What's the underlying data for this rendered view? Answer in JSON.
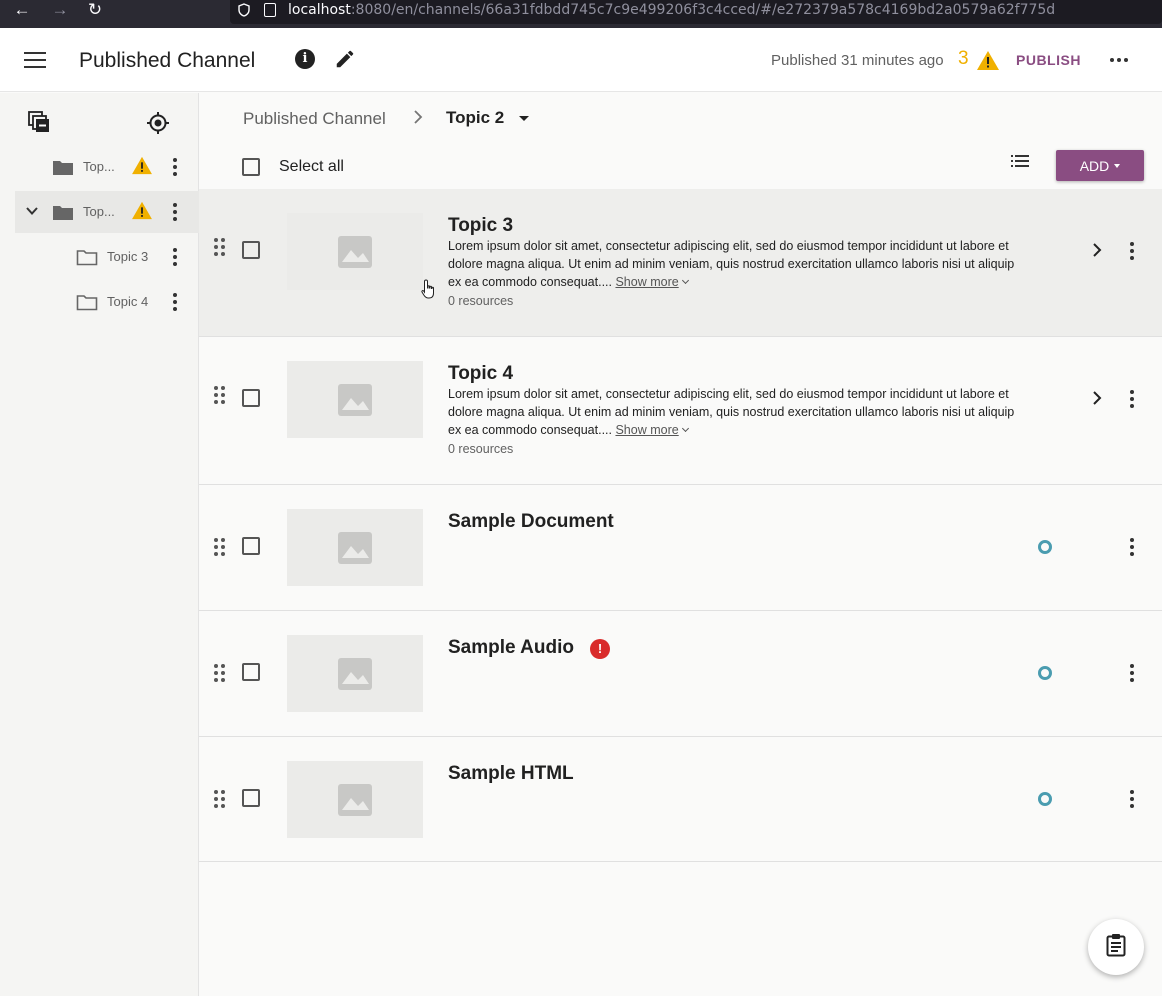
{
  "browser": {
    "url_host": "localhost",
    "url_rest": ":8080/en/channels/66a31fdbdd745c7c9e499206f3c4cced/#/e272379a578c4169bd2a0579a62f775d"
  },
  "header": {
    "title": "Published Channel",
    "status": "Published 31 minutes ago",
    "warning_count": "3",
    "publish_label": "PUBLISH"
  },
  "sidebar": {
    "items": [
      {
        "label": "Top...",
        "warning": true
      },
      {
        "label": "Top...",
        "warning": true,
        "expanded": true
      },
      {
        "label": "Topic 3"
      },
      {
        "label": "Topic 4"
      }
    ]
  },
  "main": {
    "breadcrumb_root": "Published Channel",
    "breadcrumb_current": "Topic 2",
    "select_all": "Select all",
    "add_label": "ADD",
    "rows": [
      {
        "title": "Topic 3",
        "description": "Lorem ipsum dolor sit amet, consectetur adipiscing elit, sed do eiusmod tempor incididunt ut labore et dolore magna aliqua. Ut enim ad minim veniam, quis nostrud exercitation ullamco laboris nisi ut aliquip ex ea commodo consequat.... ",
        "show_more": "Show more",
        "resources": "0 resources"
      },
      {
        "title": "Topic 4",
        "description": "Lorem ipsum dolor sit amet, consectetur adipiscing elit, sed do eiusmod tempor incididunt ut labore et dolore magna aliqua. Ut enim ad minim veniam, quis nostrud exercitation ullamco laboris nisi ut aliquip ex ea commodo consequat.... ",
        "show_more": "Show more",
        "resources": "0 resources"
      },
      {
        "title": "Sample Document"
      },
      {
        "title": "Sample Audio",
        "error_mark": "!"
      },
      {
        "title": "Sample HTML"
      }
    ]
  },
  "colors": {
    "accent": "#8a4d82",
    "warning": "#f0b000",
    "error": "#d92b2b",
    "status_ring": "#4a9cb0"
  }
}
